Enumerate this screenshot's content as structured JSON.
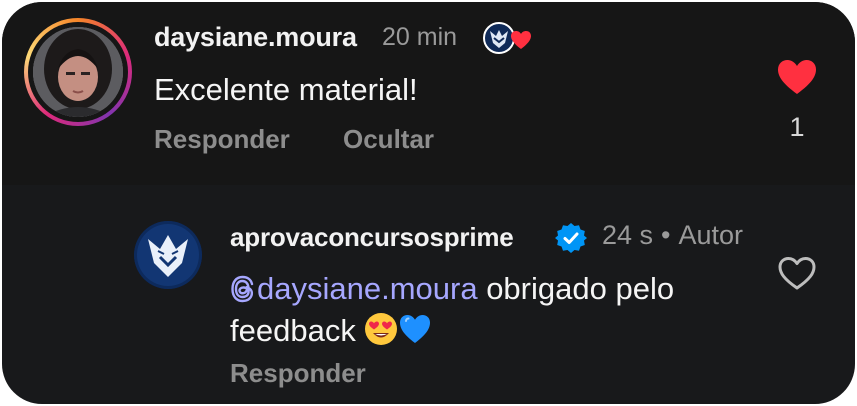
{
  "comment": {
    "username": "daysiane.moura",
    "time": "20 min",
    "text": "Excelente material!",
    "reply_label": "Responder",
    "hide_label": "Ocultar",
    "like_count": "1",
    "liked": true,
    "heart_color": "#ff3040"
  },
  "reply": {
    "username": "aprovaconcursosprime",
    "verified": true,
    "time": "24 s",
    "separator": "•",
    "author_label": "Autor",
    "mention": "daysiane.moura",
    "text_after_mention": " obrigado pelo feedback ",
    "emojis": [
      "heart-eyes-emoji",
      "blue-heart-emoji"
    ],
    "reply_label": "Responder",
    "liked": false,
    "mention_color": "#a6a7ff",
    "verified_color": "#0095f6"
  }
}
